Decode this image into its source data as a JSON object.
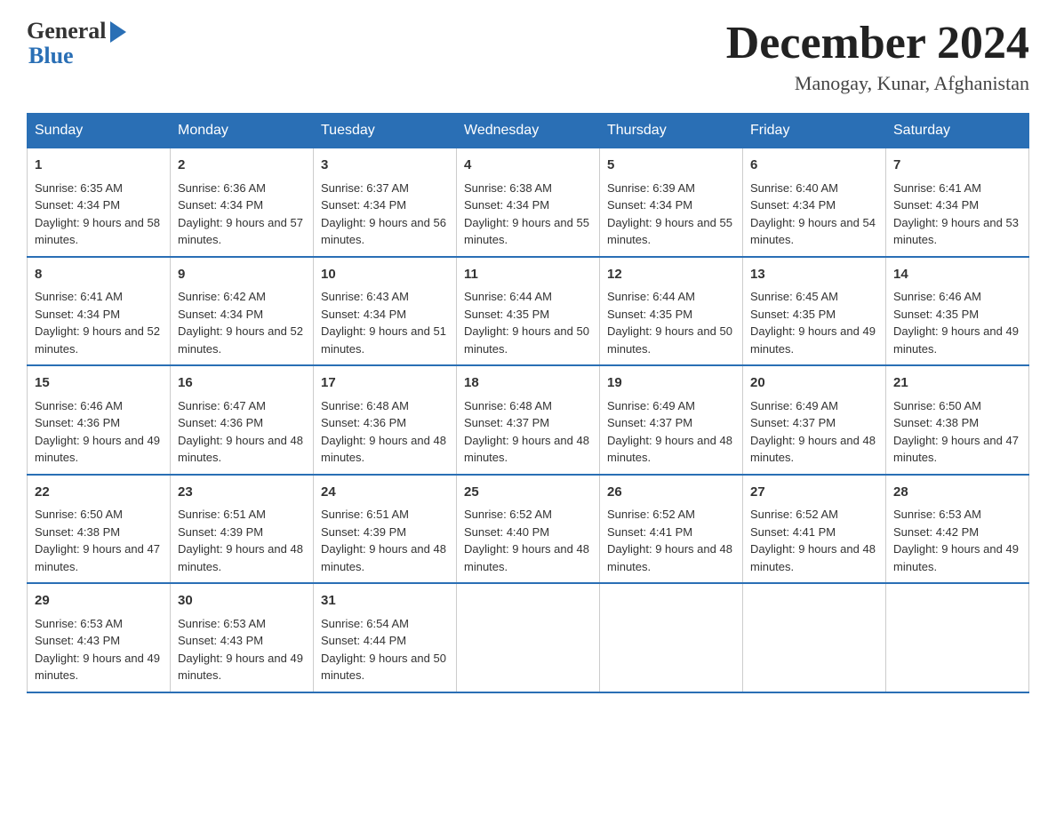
{
  "header": {
    "logo_general": "General",
    "logo_blue": "Blue",
    "month_title": "December 2024",
    "location": "Manogay, Kunar, Afghanistan"
  },
  "days_of_week": [
    "Sunday",
    "Monday",
    "Tuesday",
    "Wednesday",
    "Thursday",
    "Friday",
    "Saturday"
  ],
  "weeks": [
    [
      {
        "day": "1",
        "sunrise": "6:35 AM",
        "sunset": "4:34 PM",
        "daylight": "9 hours and 58 minutes."
      },
      {
        "day": "2",
        "sunrise": "6:36 AM",
        "sunset": "4:34 PM",
        "daylight": "9 hours and 57 minutes."
      },
      {
        "day": "3",
        "sunrise": "6:37 AM",
        "sunset": "4:34 PM",
        "daylight": "9 hours and 56 minutes."
      },
      {
        "day": "4",
        "sunrise": "6:38 AM",
        "sunset": "4:34 PM",
        "daylight": "9 hours and 55 minutes."
      },
      {
        "day": "5",
        "sunrise": "6:39 AM",
        "sunset": "4:34 PM",
        "daylight": "9 hours and 55 minutes."
      },
      {
        "day": "6",
        "sunrise": "6:40 AM",
        "sunset": "4:34 PM",
        "daylight": "9 hours and 54 minutes."
      },
      {
        "day": "7",
        "sunrise": "6:41 AM",
        "sunset": "4:34 PM",
        "daylight": "9 hours and 53 minutes."
      }
    ],
    [
      {
        "day": "8",
        "sunrise": "6:41 AM",
        "sunset": "4:34 PM",
        "daylight": "9 hours and 52 minutes."
      },
      {
        "day": "9",
        "sunrise": "6:42 AM",
        "sunset": "4:34 PM",
        "daylight": "9 hours and 52 minutes."
      },
      {
        "day": "10",
        "sunrise": "6:43 AM",
        "sunset": "4:34 PM",
        "daylight": "9 hours and 51 minutes."
      },
      {
        "day": "11",
        "sunrise": "6:44 AM",
        "sunset": "4:35 PM",
        "daylight": "9 hours and 50 minutes."
      },
      {
        "day": "12",
        "sunrise": "6:44 AM",
        "sunset": "4:35 PM",
        "daylight": "9 hours and 50 minutes."
      },
      {
        "day": "13",
        "sunrise": "6:45 AM",
        "sunset": "4:35 PM",
        "daylight": "9 hours and 49 minutes."
      },
      {
        "day": "14",
        "sunrise": "6:46 AM",
        "sunset": "4:35 PM",
        "daylight": "9 hours and 49 minutes."
      }
    ],
    [
      {
        "day": "15",
        "sunrise": "6:46 AM",
        "sunset": "4:36 PM",
        "daylight": "9 hours and 49 minutes."
      },
      {
        "day": "16",
        "sunrise": "6:47 AM",
        "sunset": "4:36 PM",
        "daylight": "9 hours and 48 minutes."
      },
      {
        "day": "17",
        "sunrise": "6:48 AM",
        "sunset": "4:36 PM",
        "daylight": "9 hours and 48 minutes."
      },
      {
        "day": "18",
        "sunrise": "6:48 AM",
        "sunset": "4:37 PM",
        "daylight": "9 hours and 48 minutes."
      },
      {
        "day": "19",
        "sunrise": "6:49 AM",
        "sunset": "4:37 PM",
        "daylight": "9 hours and 48 minutes."
      },
      {
        "day": "20",
        "sunrise": "6:49 AM",
        "sunset": "4:37 PM",
        "daylight": "9 hours and 48 minutes."
      },
      {
        "day": "21",
        "sunrise": "6:50 AM",
        "sunset": "4:38 PM",
        "daylight": "9 hours and 47 minutes."
      }
    ],
    [
      {
        "day": "22",
        "sunrise": "6:50 AM",
        "sunset": "4:38 PM",
        "daylight": "9 hours and 47 minutes."
      },
      {
        "day": "23",
        "sunrise": "6:51 AM",
        "sunset": "4:39 PM",
        "daylight": "9 hours and 48 minutes."
      },
      {
        "day": "24",
        "sunrise": "6:51 AM",
        "sunset": "4:39 PM",
        "daylight": "9 hours and 48 minutes."
      },
      {
        "day": "25",
        "sunrise": "6:52 AM",
        "sunset": "4:40 PM",
        "daylight": "9 hours and 48 minutes."
      },
      {
        "day": "26",
        "sunrise": "6:52 AM",
        "sunset": "4:41 PM",
        "daylight": "9 hours and 48 minutes."
      },
      {
        "day": "27",
        "sunrise": "6:52 AM",
        "sunset": "4:41 PM",
        "daylight": "9 hours and 48 minutes."
      },
      {
        "day": "28",
        "sunrise": "6:53 AM",
        "sunset": "4:42 PM",
        "daylight": "9 hours and 49 minutes."
      }
    ],
    [
      {
        "day": "29",
        "sunrise": "6:53 AM",
        "sunset": "4:43 PM",
        "daylight": "9 hours and 49 minutes."
      },
      {
        "day": "30",
        "sunrise": "6:53 AM",
        "sunset": "4:43 PM",
        "daylight": "9 hours and 49 minutes."
      },
      {
        "day": "31",
        "sunrise": "6:54 AM",
        "sunset": "4:44 PM",
        "daylight": "9 hours and 50 minutes."
      },
      null,
      null,
      null,
      null
    ]
  ]
}
